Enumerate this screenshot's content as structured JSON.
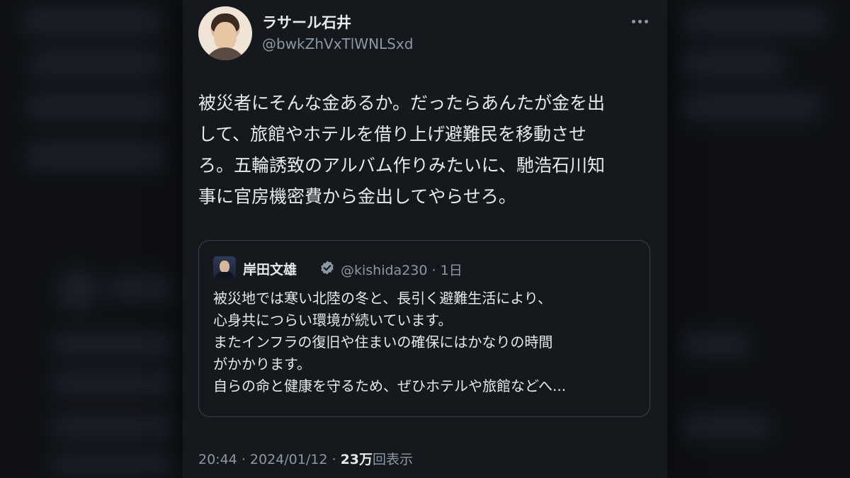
{
  "tweet": {
    "display_name": "ラサール石井",
    "handle": "@bwkZhVxTlWNLSxd",
    "body_lines": [
      "被災者にそんな金あるか。だったらあんたが金を出",
      "して、旅館やホテルを借り上げ避難民を移動させ",
      "ろ。五輪誘致のアルバム作りみたいに、馳浩石川知",
      "事に官房機密費から金出してやらせろ。"
    ],
    "time": "20:44",
    "date": "2024/01/12",
    "views_count": "23万",
    "views_label": "回表示",
    "separator": "·"
  },
  "quote": {
    "display_name": "岸田文雄",
    "handle": "@kishida230",
    "age": "1日",
    "separator": "·",
    "body_lines": [
      "被災地では寒い北陸の冬と、長引く避難生活により、",
      "心身共につらい環境が続いています。",
      "またインフラの復旧や住まいの確保にはかなりの時間",
      "がかかります。",
      "自らの命と健康を守るため、ぜひホテルや旅館などへ..."
    ]
  },
  "icons": {
    "more": "more-dots-icon",
    "verified": "verified-badge-icon"
  },
  "colors": {
    "background": "#15181d",
    "text": "#e7e9ea",
    "secondary": "#8b98a5",
    "border": "#3b4148",
    "verified": "#8b98a5"
  }
}
